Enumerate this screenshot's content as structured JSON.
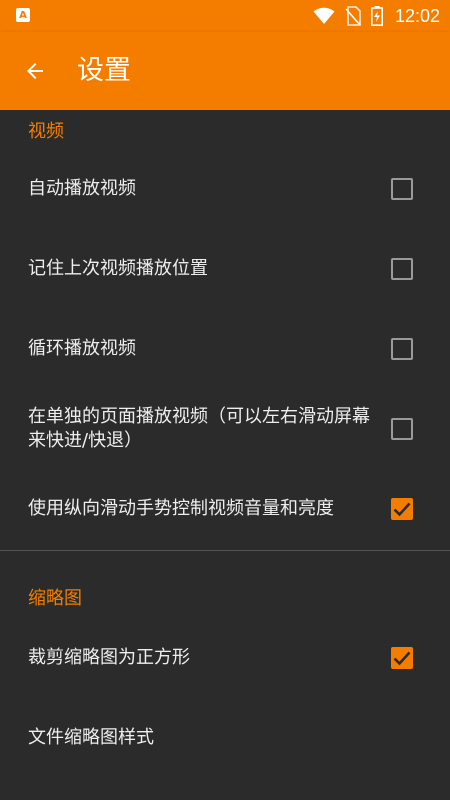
{
  "colors": {
    "accent": "#f47d00",
    "background": "#2b2b2b",
    "text": "#eeeeee",
    "checkbox_off": "#9a9a9a"
  },
  "status_bar": {
    "app_icon": "A",
    "time": "12:02",
    "icons": [
      "wifi-icon",
      "no-sim-icon",
      "battery-charging-icon"
    ]
  },
  "toolbar": {
    "back_icon": "arrow-left-icon",
    "title": "设置"
  },
  "sections": [
    {
      "header": "视频",
      "items": [
        {
          "label": "自动播放视频",
          "checked": false
        },
        {
          "label": "记住上次视频播放位置",
          "checked": false
        },
        {
          "label": "循环播放视频",
          "checked": false
        },
        {
          "label": "在单独的页面播放视频（可以左右滑动屏幕来快进/快退）",
          "checked": false
        },
        {
          "label": "使用纵向滑动手势控制视频音量和亮度",
          "checked": true
        }
      ]
    },
    {
      "header": "缩略图",
      "items": [
        {
          "label": "裁剪缩略图为正方形",
          "checked": true
        },
        {
          "label": "文件缩略图样式"
        }
      ]
    }
  ]
}
